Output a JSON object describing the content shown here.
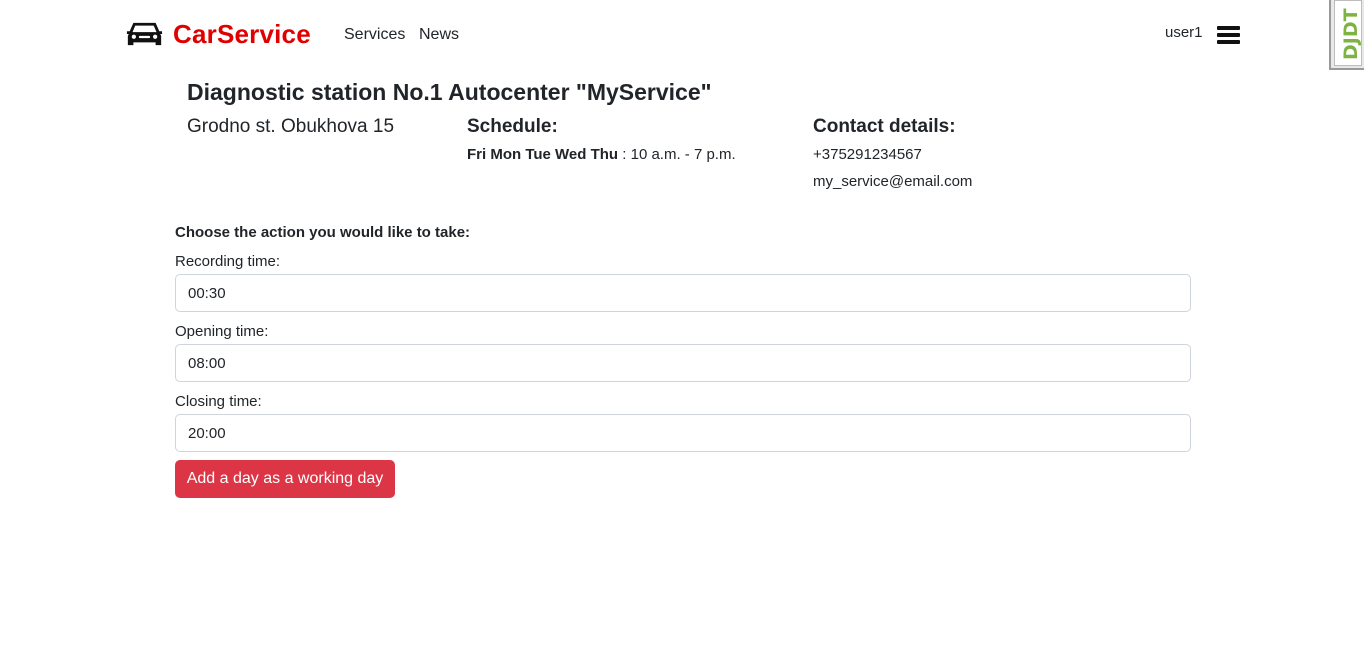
{
  "navbar": {
    "brand": "CarService",
    "brand_icon": "car-icon",
    "links": [
      {
        "label": "Services"
      },
      {
        "label": "News"
      }
    ],
    "user": "user1",
    "menu_icon": "hamburger-menu-icon"
  },
  "extension_badge": {
    "text": "DJDT"
  },
  "station": {
    "title": "Diagnostic station No.1 Autocenter \"MyService\"",
    "address": "Grodno st. Obukhova 15",
    "schedule_title": "Schedule:",
    "schedule_days": "Fri Mon Tue Wed Thu",
    "schedule_hours": " : 10 a.m. - 7 p.m.",
    "contact_title": "Contact details:",
    "phone": "+375291234567",
    "email": "my_service@email.com"
  },
  "form": {
    "heading": "Choose the action you would like to take:",
    "recording_label": "Recording time:",
    "recording_value": "00:30",
    "opening_label": "Opening time:",
    "opening_value": "08:00",
    "closing_label": "Closing time:",
    "closing_value": "20:00",
    "submit_label": "Add a day as a working day"
  },
  "colors": {
    "brand": "#e00000",
    "button": "#dc3545",
    "input_border": "#ced4da",
    "text": "#212529"
  }
}
